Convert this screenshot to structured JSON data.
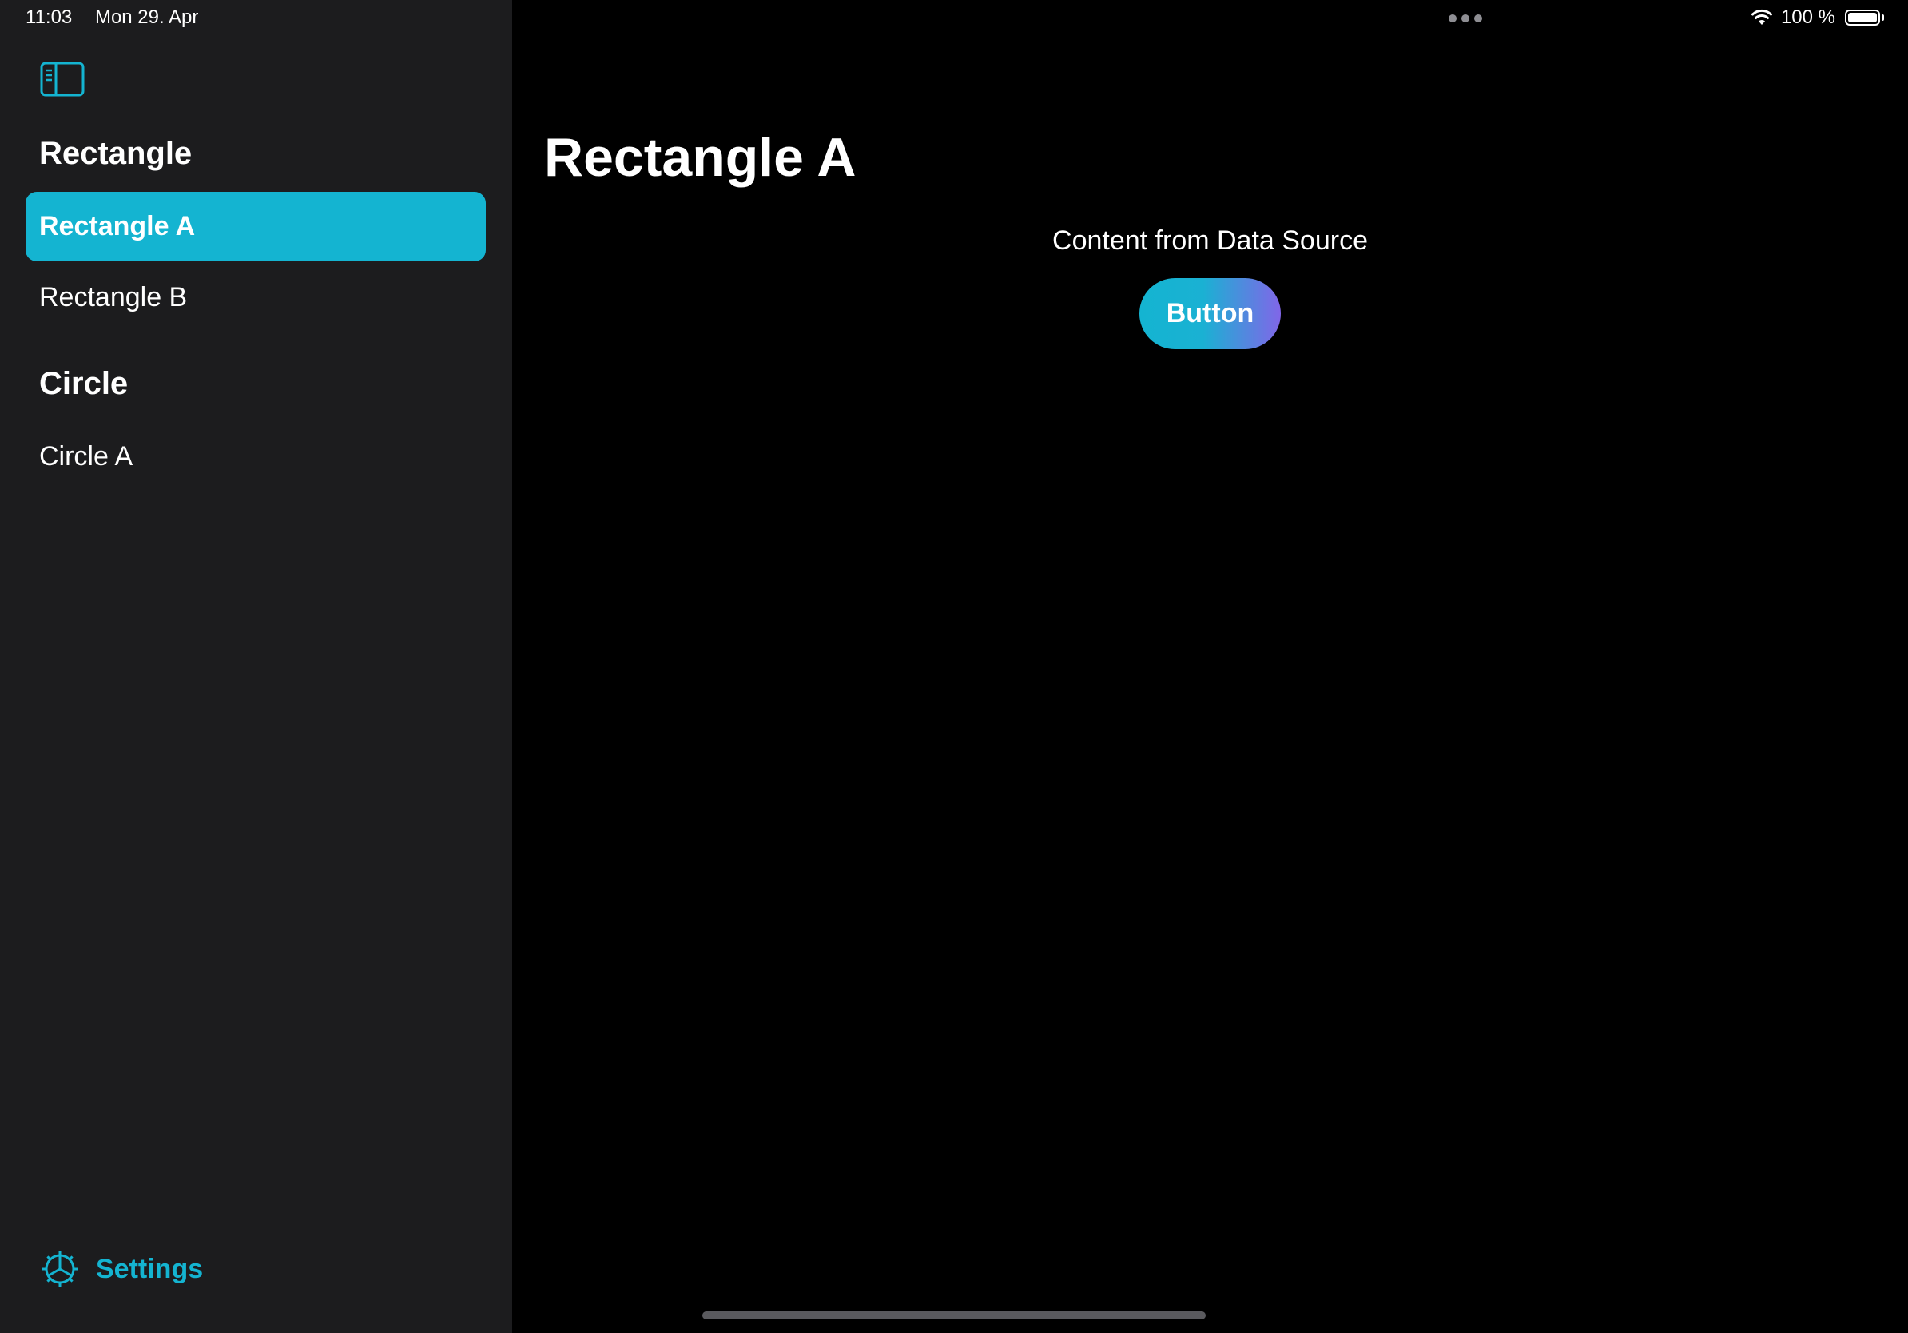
{
  "status_bar": {
    "time": "11:03",
    "date": "Mon 29. Apr",
    "battery_text": "100 %",
    "battery_level": 1.0
  },
  "sidebar": {
    "toggle_icon": "sidebar-left-icon",
    "sections": [
      {
        "heading": "Rectangle",
        "items": [
          {
            "label": "Rectangle A",
            "selected": true
          },
          {
            "label": "Rectangle B",
            "selected": false
          }
        ]
      },
      {
        "heading": "Circle",
        "items": [
          {
            "label": "Circle A",
            "selected": false
          }
        ]
      }
    ],
    "settings": {
      "icon": "gear-icon",
      "label": "Settings"
    }
  },
  "detail": {
    "title": "Rectangle A",
    "content_text": "Content from Data Source",
    "button_label": "Button"
  },
  "colors": {
    "accent": "#14b4d1",
    "gradient_end": "#8166e8",
    "sidebar_bg": "#1c1c1e",
    "detail_bg": "#000000"
  }
}
